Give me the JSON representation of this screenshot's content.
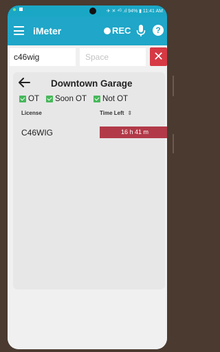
{
  "statusbar": {
    "right_text": "✈ ✕ ⁴ᴳ .ıl 94% ▮ 11:41 AM"
  },
  "appbar": {
    "title": "iMeter",
    "rec_label": "REC",
    "help_label": "?"
  },
  "search": {
    "license_value": "c46wig",
    "space_placeholder": "Space",
    "clear_label": "✕"
  },
  "card": {
    "title": "Downtown Garage",
    "filters": [
      {
        "label": "OT",
        "checked": true
      },
      {
        "label": "Soon OT",
        "checked": true
      },
      {
        "label": "Not OT",
        "checked": true
      }
    ],
    "columns": {
      "license": "License",
      "time_left": "Time Left"
    },
    "rows": [
      {
        "license": "C46WIG",
        "time_left": "16 h 41 m"
      }
    ]
  },
  "colors": {
    "appbar": "#1fa6c8",
    "accent_red": "#d63944",
    "time_bar": "#b23a48",
    "checkbox": "#47b85b"
  },
  "icons": {
    "menu": "hamburger-icon",
    "rec": "record-dot-icon",
    "mic": "microphone-icon",
    "help": "help-icon",
    "back": "back-arrow-icon",
    "sort": "sort-icon"
  }
}
